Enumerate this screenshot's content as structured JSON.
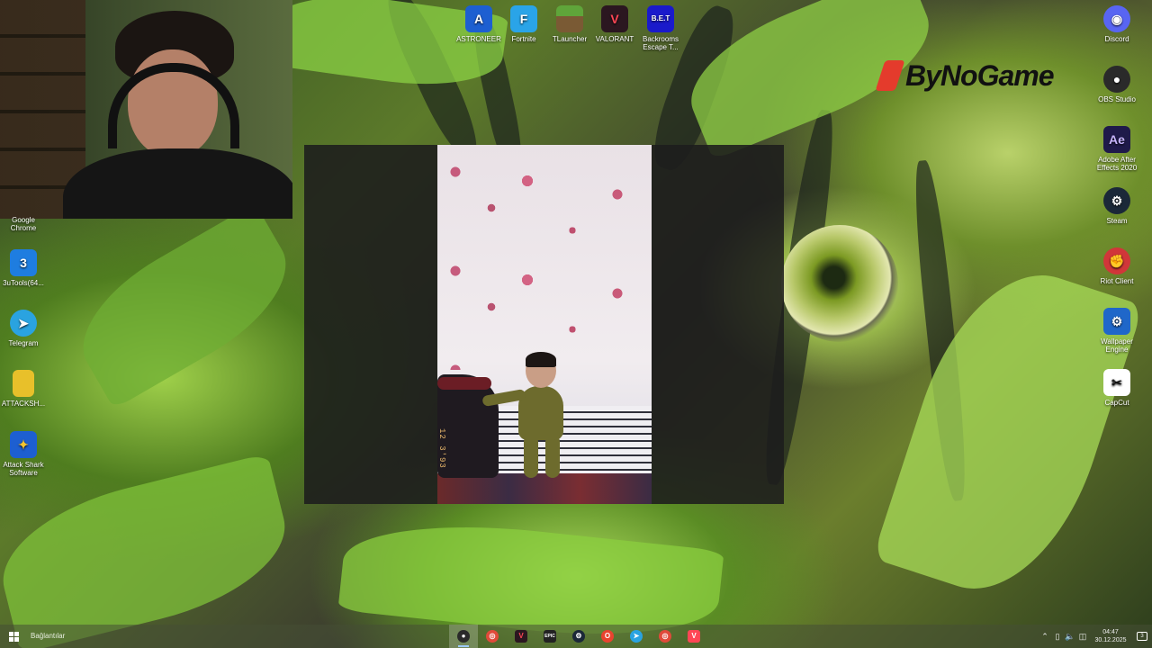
{
  "desktop": {
    "top_icons": [
      {
        "label": "ASTRONEER",
        "icon": "astroneer-icon",
        "color": "#1d5fd1",
        "glyph": "A"
      },
      {
        "label": "Fortnite",
        "icon": "fortnite-icon",
        "color": "#2aa4e8",
        "glyph": "F"
      },
      {
        "label": "TLauncher",
        "icon": "minecraft-icon",
        "color": "#4f8a2b",
        "glyph": ""
      },
      {
        "label": "VALORANT",
        "icon": "valorant-icon",
        "color": "#2b1720",
        "glyph": "V"
      },
      {
        "label": "Backrooms Escape T...",
        "icon": "backrooms-icon",
        "color": "#1a1acb",
        "glyph": "B.E.T"
      }
    ],
    "left_icons": [
      {
        "label": "Google Chrome",
        "icon": "chrome-icon"
      },
      {
        "label": "3uTools(64...",
        "icon": "3utools-icon",
        "color": "#1e7de0",
        "glyph": "3"
      },
      {
        "label": "Telegram",
        "icon": "telegram-icon",
        "color": "#2aa3e0",
        "glyph": "➤"
      },
      {
        "label": "ATTACKSH...",
        "icon": "folder-icon",
        "color": "#e8c02a",
        "glyph": ""
      },
      {
        "label": "Attack Shark Software",
        "icon": "attack-shark-icon",
        "color": "#1d5fd1",
        "glyph": "✦"
      }
    ],
    "right_icons": [
      {
        "label": "Discord",
        "icon": "discord-icon",
        "color": "#5865f2",
        "glyph": "◉"
      },
      {
        "label": "OBS Studio",
        "icon": "obs-icon",
        "color": "#2a2a2a",
        "glyph": "●"
      },
      {
        "label": "Adobe After Effects 2020",
        "icon": "after-effects-icon",
        "color": "#1f1a4a",
        "glyph": "Ae"
      },
      {
        "label": "Steam",
        "icon": "steam-icon",
        "color": "#1b2838",
        "glyph": "⚙"
      },
      {
        "label": "Riot Client",
        "icon": "riot-client-icon",
        "color": "#d13639",
        "glyph": "✊"
      },
      {
        "label": "Wallpaper Engine",
        "icon": "wallpaper-engine-icon",
        "color": "#1f67c9",
        "glyph": "⚙"
      },
      {
        "label": "CapCut",
        "icon": "capcut-icon",
        "color": "#ffffff",
        "glyph": "✂"
      }
    ]
  },
  "watermark": {
    "text": "ByNoGame",
    "accent": "#e43b2c"
  },
  "photo": {
    "date_stamp": "12 3'93"
  },
  "taskbar": {
    "search_label": "Bağlantılar",
    "apps": [
      {
        "icon": "obs-icon",
        "color": "#2a2a2a",
        "glyph": "●",
        "active": true
      },
      {
        "icon": "chrome-icon",
        "color": "#e04a3a",
        "glyph": "◎",
        "active": false
      },
      {
        "icon": "valorant-icon",
        "color": "#2b1720",
        "glyph": "V",
        "active": false
      },
      {
        "icon": "epic-games-icon",
        "color": "#222222",
        "glyph": "EPIC",
        "active": false
      },
      {
        "icon": "steam-icon",
        "color": "#1b2838",
        "glyph": "⚙",
        "active": false
      },
      {
        "icon": "opera-icon",
        "color": "#e8432f",
        "glyph": "O",
        "active": false
      },
      {
        "icon": "telegram-icon",
        "color": "#2aa3e0",
        "glyph": "➤",
        "active": false
      },
      {
        "icon": "chrome-icon",
        "color": "#e04a3a",
        "glyph": "◎",
        "active": false
      },
      {
        "icon": "valorant-icon",
        "color": "#ff4655",
        "glyph": "V",
        "active": false
      }
    ],
    "clock_time": "04:47",
    "clock_date": "30.12.2025",
    "notification_count": "3"
  }
}
